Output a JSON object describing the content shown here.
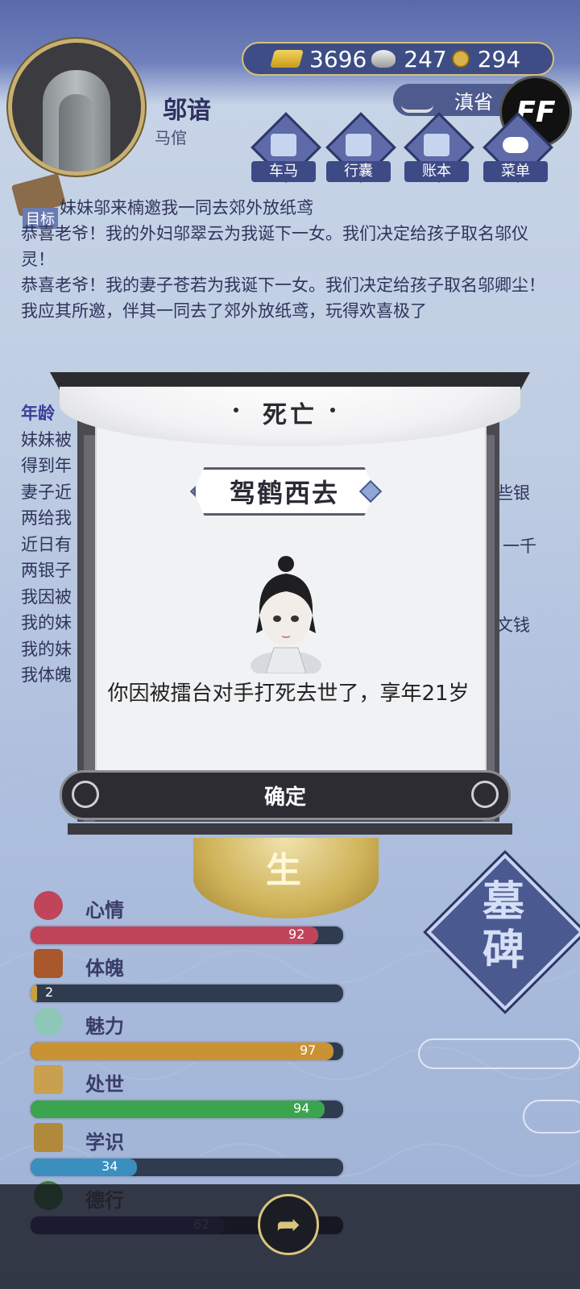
{
  "player": {
    "name": "邬谙",
    "occupation": "马倌"
  },
  "currency": {
    "gold": "3696",
    "silver": "247",
    "copper": "294"
  },
  "region": "滇省",
  "ff_label": "FF",
  "menu": [
    {
      "label": "车马",
      "icon": "carriage-icon"
    },
    {
      "label": "行囊",
      "icon": "bag-icon"
    },
    {
      "label": "账本",
      "icon": "ledger-icon"
    },
    {
      "label": "菜单",
      "icon": "more-icon"
    }
  ],
  "goal_label": "目标",
  "log_top": [
    "妹妹邬来楠邀我一同去郊外放纸鸢",
    "恭喜老爷！我的外妇邬翠云为我诞下一女。我们决定给孩子取名邬仪灵！",
    "恭喜老爷！我的妻子苍若为我诞下一女。我们决定给孩子取名邬卿尘！",
    "我应其所邀，伴其一同去了郊外放纸鸢，玩得欢喜极了"
  ],
  "log_year_fragment": "年龄",
  "log_bottom_fragments": [
    "妹妹被",
    "得到年",
    "妻子近",
    "两给我",
    "近日有",
    "两银子",
    "我因被",
    "我的妹",
    "我的妹",
    "我体魄"
  ],
  "log_right_fragments": [
    "些银",
    "一千",
    "文钱"
  ],
  "modal": {
    "title": "死亡",
    "heading": "驾鹤西去",
    "message": "你因被擂台对手打死去世了，享年21岁",
    "confirm_label": "确定"
  },
  "emblem_text": "生",
  "stats": [
    {
      "label": "心情",
      "value": 92,
      "color": "#c0455a",
      "icon": "flower-icon"
    },
    {
      "label": "体魄",
      "value": 2,
      "color": "#c9a13a",
      "icon": "body-icon"
    },
    {
      "label": "魅力",
      "value": 97,
      "color": "#c99334",
      "icon": "mirror-icon"
    },
    {
      "label": "处世",
      "value": 94,
      "color": "#3aa44e",
      "icon": "fan-icon"
    },
    {
      "label": "学识",
      "value": 34,
      "color": "#3a8fbf",
      "icon": "books-icon"
    },
    {
      "label": "德行",
      "value": 62,
      "color": "#3a2a6a",
      "icon": "jade-icon"
    }
  ],
  "tomb_label": "墓碑"
}
